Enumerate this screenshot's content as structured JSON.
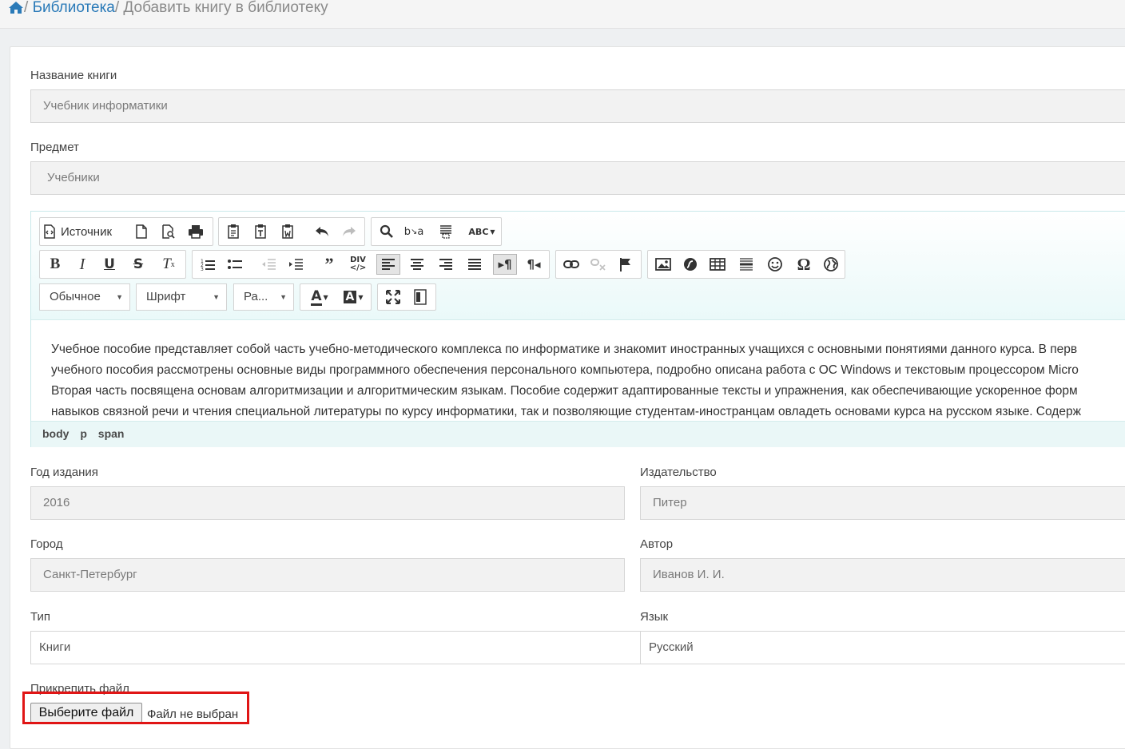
{
  "breadcrumb": {
    "home_sep": "/ ",
    "library": "Библиотека",
    "current": "/ Добавить книгу в библиотеку"
  },
  "form": {
    "title_label": "Название книги",
    "title_value": "Учебник информатики",
    "subject_label": "Предмет",
    "subject_value": "Учебники",
    "year_label": "Год издания",
    "year_value": "2016",
    "publisher_label": "Издательство",
    "publisher_value": "Питер",
    "city_label": "Город",
    "city_value": "Санкт-Петербург",
    "author_label": "Автор",
    "author_value": "Иванов И. И.",
    "type_label": "Тип",
    "type_value": "Книги",
    "language_label": "Язык",
    "language_value": "Русский",
    "attach_label": "Прикрепить файл",
    "file_button": "Выберите файл",
    "file_status": "Файл не выбран"
  },
  "editor": {
    "source_label": "Источник",
    "format_combo": "Обычное",
    "font_combo": "Шрифт",
    "size_combo": "Ра...",
    "lines": [
      "Учебное пособие представляет собой часть учебно-методического комплекса по информатике и знакомит иностранных учащихся с основными понятиями данного курса. В перв",
      "учебного пособия рассмотрены основные виды программного обеспечения персонального компьютера, подробно описана работа с ОС Windows и текстовым процессором Micro",
      "Вторая часть посвящена основам алгоритмизации и алгоритмическим языкам. Пособие содержит адаптированные тексты и упражнения, как обеспечивающие ускоренное форм",
      "навыков связной речи и чтения специальной литературы по курсу информатики, так и позволяющие студентам-иностранцам овладеть основами курса на русском языке. Содерж"
    ],
    "path": [
      "body",
      "p",
      "span"
    ]
  },
  "colors": {
    "link": "#2a7ab8",
    "highlight": "#e01515",
    "editor_border": "#c9e9ea"
  }
}
